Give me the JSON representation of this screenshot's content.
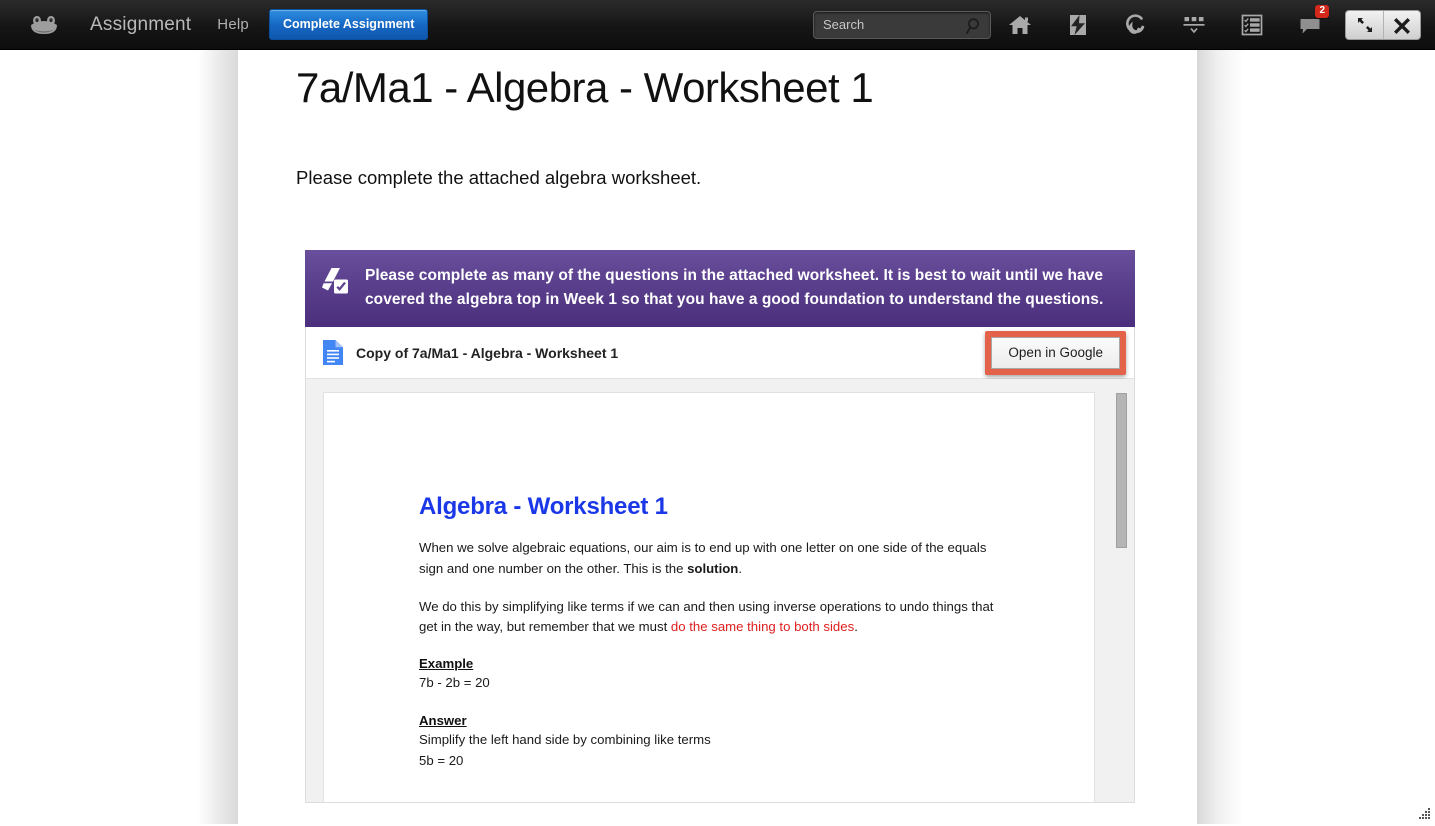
{
  "topbar": {
    "logo": "frog-logo",
    "app_label": "Assignment",
    "help_label": "Help",
    "complete_button": "Complete Assignment",
    "search": {
      "placeholder": "Search",
      "value": "",
      "icon": "magnifier-icon"
    },
    "icons": [
      {
        "name": "home-icon",
        "label": "Home"
      },
      {
        "name": "lightning-bolt-icon",
        "label": "Quick Launch"
      },
      {
        "name": "spiral-icon",
        "label": "Sites"
      },
      {
        "name": "apps-dropdown-icon",
        "label": "Apps"
      },
      {
        "name": "checklist-icon",
        "label": "Markbook"
      },
      {
        "name": "chat-bubble-icon",
        "label": "Messages"
      }
    ],
    "notification_badge": "2",
    "window_buttons": [
      {
        "name": "restore-icon",
        "label": "Restore"
      },
      {
        "name": "close-icon",
        "label": "Close"
      }
    ],
    "colors": {
      "bar_top": "#2b2b2b",
      "bar_bottom": "#0e0e0e",
      "button_blue": "#1668c4",
      "badge_red": "#d4281c"
    }
  },
  "page": {
    "title": "7a/Ma1 - Algebra - Worksheet 1",
    "intro": "Please complete the attached algebra worksheet."
  },
  "attachment": {
    "banner_icon": "google-drive-assignment-icon",
    "banner_text": "Please complete as many of the questions in the attached worksheet. It is best to wait until we have covered the algebra top in Week 1 so that you have a good foundation to understand the questions.",
    "banner_color_top": "#6a4f9c",
    "banner_color_bottom": "#4b2f7d",
    "file_icon": "google-docs-icon",
    "file_name": "Copy of 7a/Ma1 - Algebra - Worksheet 1",
    "open_button": "Open in Google",
    "open_button_highlight_color": "#e4614a"
  },
  "document": {
    "heading": "Algebra - Worksheet 1",
    "heading_color": "#1a37e8",
    "paragraph1_a": "When we solve algebraic equations, our aim is to end up with one letter on one side of the equals sign and one number on the other.  This is the ",
    "paragraph1_bold": "solution",
    "paragraph1_b": ".",
    "paragraph2_a": "We do this by simplifying like terms if we can and then using inverse operations to undo things that get in the way, but remember that we must ",
    "paragraph2_red": "do the same thing to both sides",
    "paragraph2_b": ".",
    "red_color": "#e02020",
    "example_heading": "Example",
    "example_line": "7b - 2b = 20",
    "answer_heading": "Answer",
    "answer_line1": "Simplify the left hand side by combining like terms",
    "answer_line2": "5b = 20"
  },
  "misc": {
    "resize_grip": "resize-grip-icon"
  }
}
